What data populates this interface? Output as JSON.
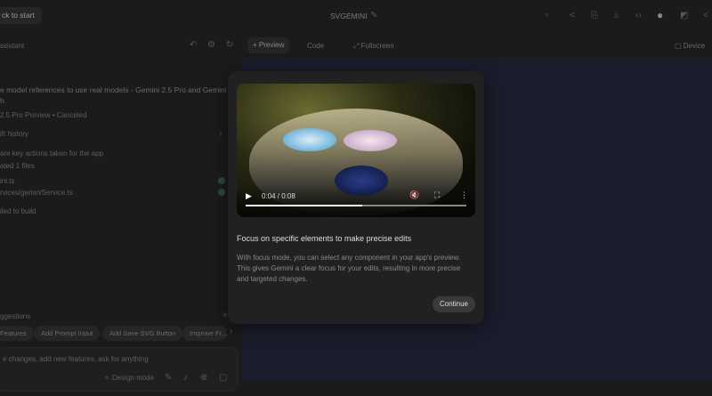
{
  "header": {
    "back_label": "ck to start",
    "app_title": "SVGEMINI",
    "right_icons": [
      "monitor-icon",
      "share-icon",
      "copy-icon",
      "upload-icon",
      "code-icon",
      "github-icon",
      "rocket-icon"
    ]
  },
  "left": {
    "subtitle": "ssistant",
    "message": "e model references to use real models - Gemini 2.5 Pro and Gemini",
    "message2": "h",
    "meta": "2.5 Pro Preview  •  Canceled",
    "history": "ift history",
    "summary": "are key actions taken for the app",
    "files": "ated 1 files",
    "file1": "ini.ts",
    "file2": "rvices/geminiService.ts",
    "status": "iled to build",
    "suggestions_title": "ggestions",
    "chips": [
      "Features",
      "Add Prompt Input",
      "Add Save SVG Button",
      "Improve Fr..."
    ],
    "input_placeholder": "e changes, add new features, ask for anything",
    "design_mode": "Design mode"
  },
  "tabs": {
    "preview": "Preview",
    "code": "Code",
    "fullscreen": "Fullscreen",
    "device": "Device"
  },
  "modal": {
    "video_time": "0:04 / 0:08",
    "video_progress": 0.53,
    "title": "Focus on specific elements to make precise edits",
    "body": "With focus mode, you can select any component in your app's preview. This gives Gemini a clear focus for your edits, resulting in more precise and targeted changes.",
    "continue_label": "Continue"
  }
}
